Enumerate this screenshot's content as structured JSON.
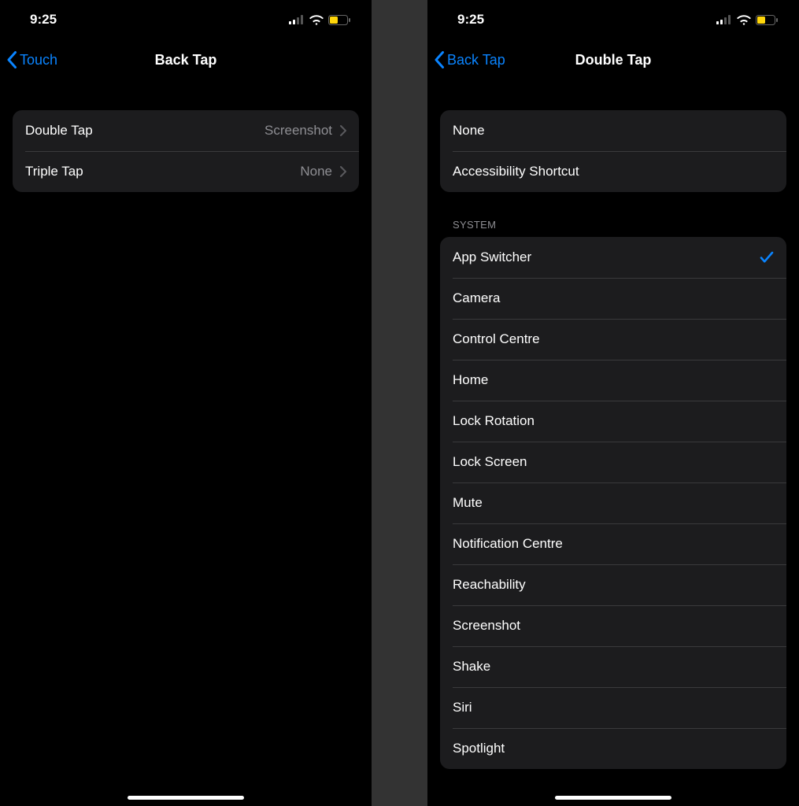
{
  "status": {
    "time": "9:25"
  },
  "left": {
    "back_label": "Touch",
    "title": "Back Tap",
    "rows": [
      {
        "label": "Double Tap",
        "value": "Screenshot"
      },
      {
        "label": "Triple Tap",
        "value": "None"
      }
    ]
  },
  "right": {
    "back_label": "Back Tap",
    "title": "Double Tap",
    "group_top": [
      {
        "label": "None",
        "selected": false
      },
      {
        "label": "Accessibility Shortcut",
        "selected": false
      }
    ],
    "system_header": "SYSTEM",
    "system": [
      {
        "label": "App Switcher",
        "selected": true
      },
      {
        "label": "Camera",
        "selected": false
      },
      {
        "label": "Control Centre",
        "selected": false
      },
      {
        "label": "Home",
        "selected": false
      },
      {
        "label": "Lock Rotation",
        "selected": false
      },
      {
        "label": "Lock Screen",
        "selected": false
      },
      {
        "label": "Mute",
        "selected": false
      },
      {
        "label": "Notification Centre",
        "selected": false
      },
      {
        "label": "Reachability",
        "selected": false
      },
      {
        "label": "Screenshot",
        "selected": false
      },
      {
        "label": "Shake",
        "selected": false
      },
      {
        "label": "Siri",
        "selected": false
      },
      {
        "label": "Spotlight",
        "selected": false
      }
    ]
  },
  "colors": {
    "link": "#0a84ff",
    "cell_bg": "#1c1c1e",
    "battery_fill": "#ffd60a"
  }
}
